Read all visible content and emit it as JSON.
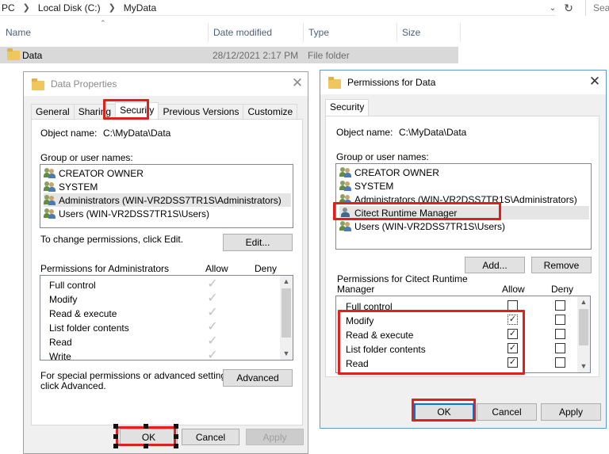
{
  "explorer": {
    "breadcrumbs": [
      "PC",
      "Local Disk (C:)",
      "MyData"
    ],
    "search_placeholder": "Sear",
    "columns": [
      "Name",
      "Date modified",
      "Type",
      "Size"
    ],
    "rows": [
      {
        "name": "Data",
        "date": "28/12/2021 2:17 PM",
        "type": "File folder"
      }
    ]
  },
  "props": {
    "title": "Data Properties",
    "tabs": [
      "General",
      "Sharing",
      "Security",
      "Previous Versions",
      "Customize"
    ],
    "object_label": "Object name:",
    "object_value": "C:\\MyData\\Data",
    "group_label": "Group or user names:",
    "users": [
      "CREATOR OWNER",
      "SYSTEM",
      "Administrators (WIN-VR2DSS7TR1S\\Administrators)",
      "Users (WIN-VR2DSS7TR1S\\Users)"
    ],
    "change_text": "To change permissions, click Edit.",
    "edit_label": "Edit...",
    "perm_for": "Permissions for Administrators",
    "allow": "Allow",
    "deny": "Deny",
    "perms": [
      "Full control",
      "Modify",
      "Read & execute",
      "List folder contents",
      "Read",
      "Write"
    ],
    "special_text_1": "For special permissions or advanced settings,",
    "special_text_2": "click Advanced.",
    "advanced_label": "Advanced",
    "ok": "OK",
    "cancel": "Cancel",
    "apply": "Apply"
  },
  "perms_dialog": {
    "title": "Permissions for Data",
    "tab": "Security",
    "object_label": "Object name:",
    "object_value": "C:\\MyData\\Data",
    "group_label": "Group or user names:",
    "users": [
      "CREATOR OWNER",
      "SYSTEM",
      "Administrators (WIN-VR2DSS7TR1S\\Administrators)",
      "Citect Runtime Manager",
      "Users (WIN-VR2DSS7TR1S\\Users)"
    ],
    "add_label": "Add...",
    "remove_label": "Remove",
    "perm_for_1": "Permissions for Citect Runtime",
    "perm_for_2": "Manager",
    "allow": "Allow",
    "deny": "Deny",
    "perms": [
      "Full control",
      "Modify",
      "Read & execute",
      "List folder contents",
      "Read"
    ],
    "allow_checked": [
      false,
      true,
      true,
      true,
      true
    ],
    "deny_checked": [
      false,
      false,
      false,
      false,
      false
    ],
    "ok": "OK",
    "cancel": "Cancel",
    "apply": "Apply"
  },
  "colors": {
    "highlight": "#e01f1f",
    "accent": "#0078d7"
  }
}
